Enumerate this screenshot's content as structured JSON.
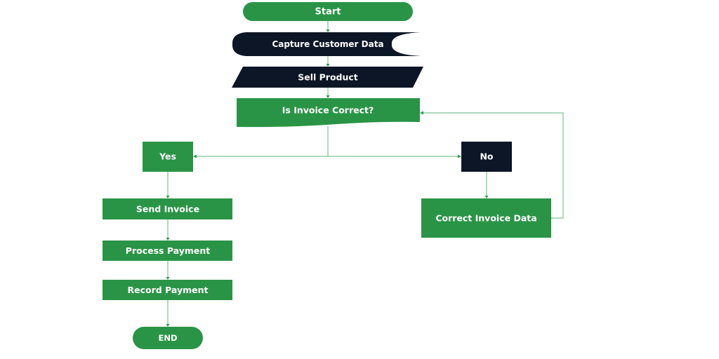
{
  "colors": {
    "green": "#2a9446",
    "navy": "#0d1626",
    "connector": "#7cc48f",
    "text": "#ffffff",
    "background": "#ffffff"
  },
  "nodes": {
    "start": {
      "label": "Start",
      "shape": "terminator"
    },
    "capture": {
      "label": "Capture Customer Data",
      "shape": "stored-data"
    },
    "sell": {
      "label": "Sell Product",
      "shape": "parallelogram"
    },
    "decision": {
      "label": "Is Invoice Correct?",
      "shape": "document"
    },
    "yes": {
      "label": "Yes",
      "shape": "rectangle"
    },
    "no": {
      "label": "No",
      "shape": "rectangle"
    },
    "send": {
      "label": "Send Invoice",
      "shape": "rectangle"
    },
    "process": {
      "label": "Process Payment",
      "shape": "rectangle"
    },
    "record": {
      "label": "Record Payment",
      "shape": "rectangle"
    },
    "correct": {
      "label": "Correct Invoice Data",
      "shape": "rectangle"
    },
    "end": {
      "label": "END",
      "shape": "terminator"
    }
  },
  "edges": [
    {
      "from": "start",
      "to": "capture"
    },
    {
      "from": "capture",
      "to": "sell"
    },
    {
      "from": "sell",
      "to": "decision"
    },
    {
      "from": "decision",
      "to": "yes"
    },
    {
      "from": "decision",
      "to": "no"
    },
    {
      "from": "yes",
      "to": "send"
    },
    {
      "from": "send",
      "to": "process"
    },
    {
      "from": "process",
      "to": "record"
    },
    {
      "from": "record",
      "to": "end"
    },
    {
      "from": "no",
      "to": "correct"
    },
    {
      "from": "correct",
      "to": "decision"
    }
  ]
}
